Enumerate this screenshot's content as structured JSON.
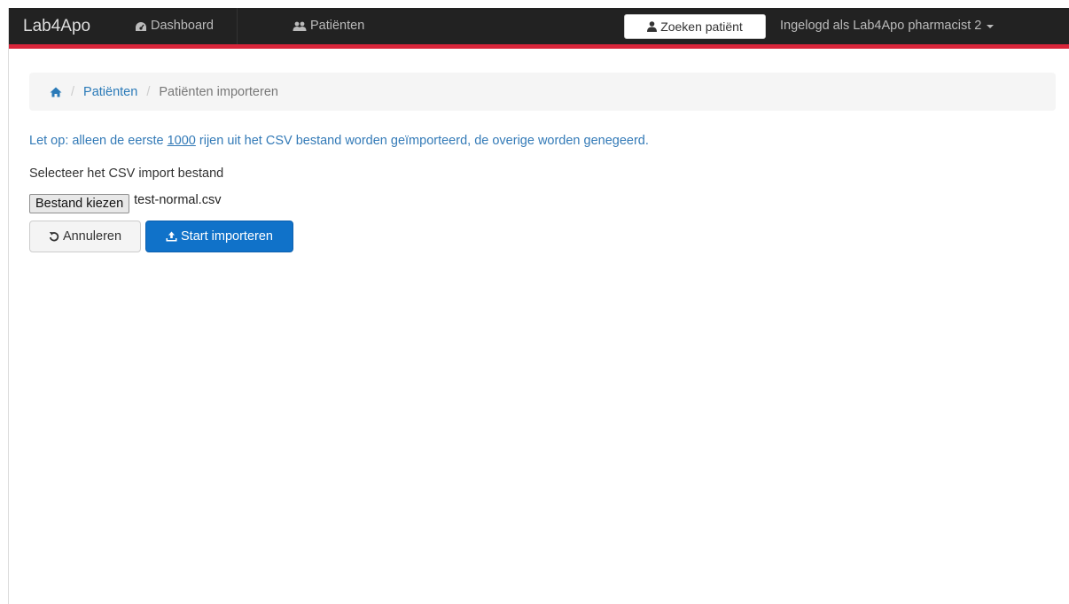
{
  "navbar": {
    "brand": "Lab4Apo",
    "dashboard_label": "Dashboard",
    "patients_label": "Patiënten",
    "search_label": "Zoeken patiënt",
    "user_label": "Ingelogd als Lab4Apo pharmacist 2",
    "accent_color": "#d9253a"
  },
  "breadcrumb": {
    "home_icon": "home-icon",
    "patients": "Patiënten",
    "current": "Patiënten importeren"
  },
  "notice": {
    "before": "Let op: alleen de eerste ",
    "limit": "1000",
    "after": " rijen uit het CSV bestand worden geïmporteerd, de overige worden genegeerd."
  },
  "form": {
    "select_label": "Selecteer het CSV import bestand",
    "file_button": "Bestand kiezen",
    "file_name": "test-normal.csv",
    "cancel_label": "Annuleren",
    "start_label": "Start importeren",
    "primary_color": "#1072c9"
  }
}
